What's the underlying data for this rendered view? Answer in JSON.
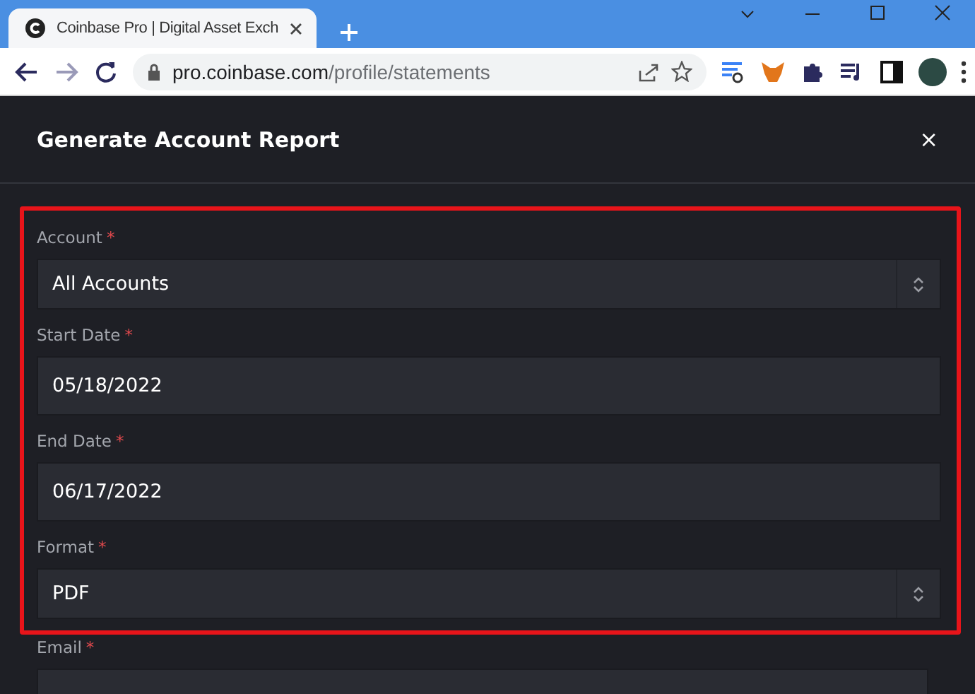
{
  "browser": {
    "tab": {
      "title": "Coinbase Pro | Digital Asset Exch",
      "selected": true
    },
    "address": {
      "host": "pro.coinbase.com",
      "path": "/profile/statements"
    }
  },
  "modal": {
    "title": "Generate Account Report",
    "close": "×",
    "fields": [
      {
        "label": "Account",
        "required_mark": "*",
        "kind": "select",
        "value": "All Accounts",
        "highlighted": true
      },
      {
        "label": "Start Date",
        "required_mark": "*",
        "kind": "input",
        "value": "05/18/2022",
        "highlighted": true
      },
      {
        "label": "End Date",
        "required_mark": "*",
        "kind": "input",
        "value": "06/17/2022",
        "highlighted": true
      },
      {
        "label": "Format",
        "required_mark": "*",
        "kind": "select",
        "value": "PDF",
        "highlighted": true
      },
      {
        "label": "Email",
        "required_mark": "*",
        "kind": "input",
        "highlighted": false
      }
    ]
  }
}
